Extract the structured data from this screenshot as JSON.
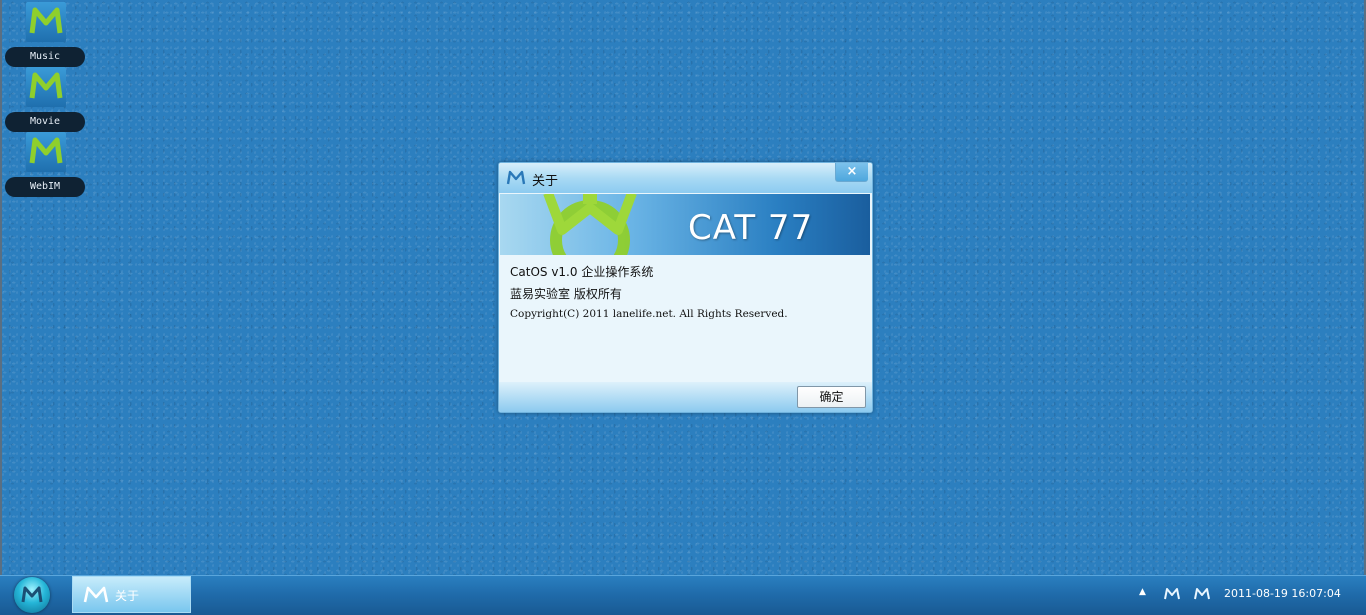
{
  "desktop": {
    "icons": [
      {
        "label": "Music",
        "icon": "m-logo-icon"
      },
      {
        "label": "Movie",
        "icon": "m-logo-icon"
      },
      {
        "label": "WebIM",
        "icon": "m-logo-icon"
      }
    ]
  },
  "dialog": {
    "title": "关于",
    "close_label": "×",
    "banner_text": "CAT 77",
    "lines": [
      "CatOS v1.0 企业操作系统",
      "蓝易实验室 版权所有",
      "Copyright(C) 2011 lanelife.net. All Rights Reserved."
    ],
    "ok_label": "确定"
  },
  "taskbar": {
    "start_icon": "start-orb-icon",
    "task_label": "关于",
    "tray_arrow": "▲",
    "clock": "2011-08-19 16:07:04"
  },
  "colors": {
    "desktop": "#2c7fbf",
    "logo_green": "#8fcf2c",
    "taskbar": "#1f6aa9"
  }
}
